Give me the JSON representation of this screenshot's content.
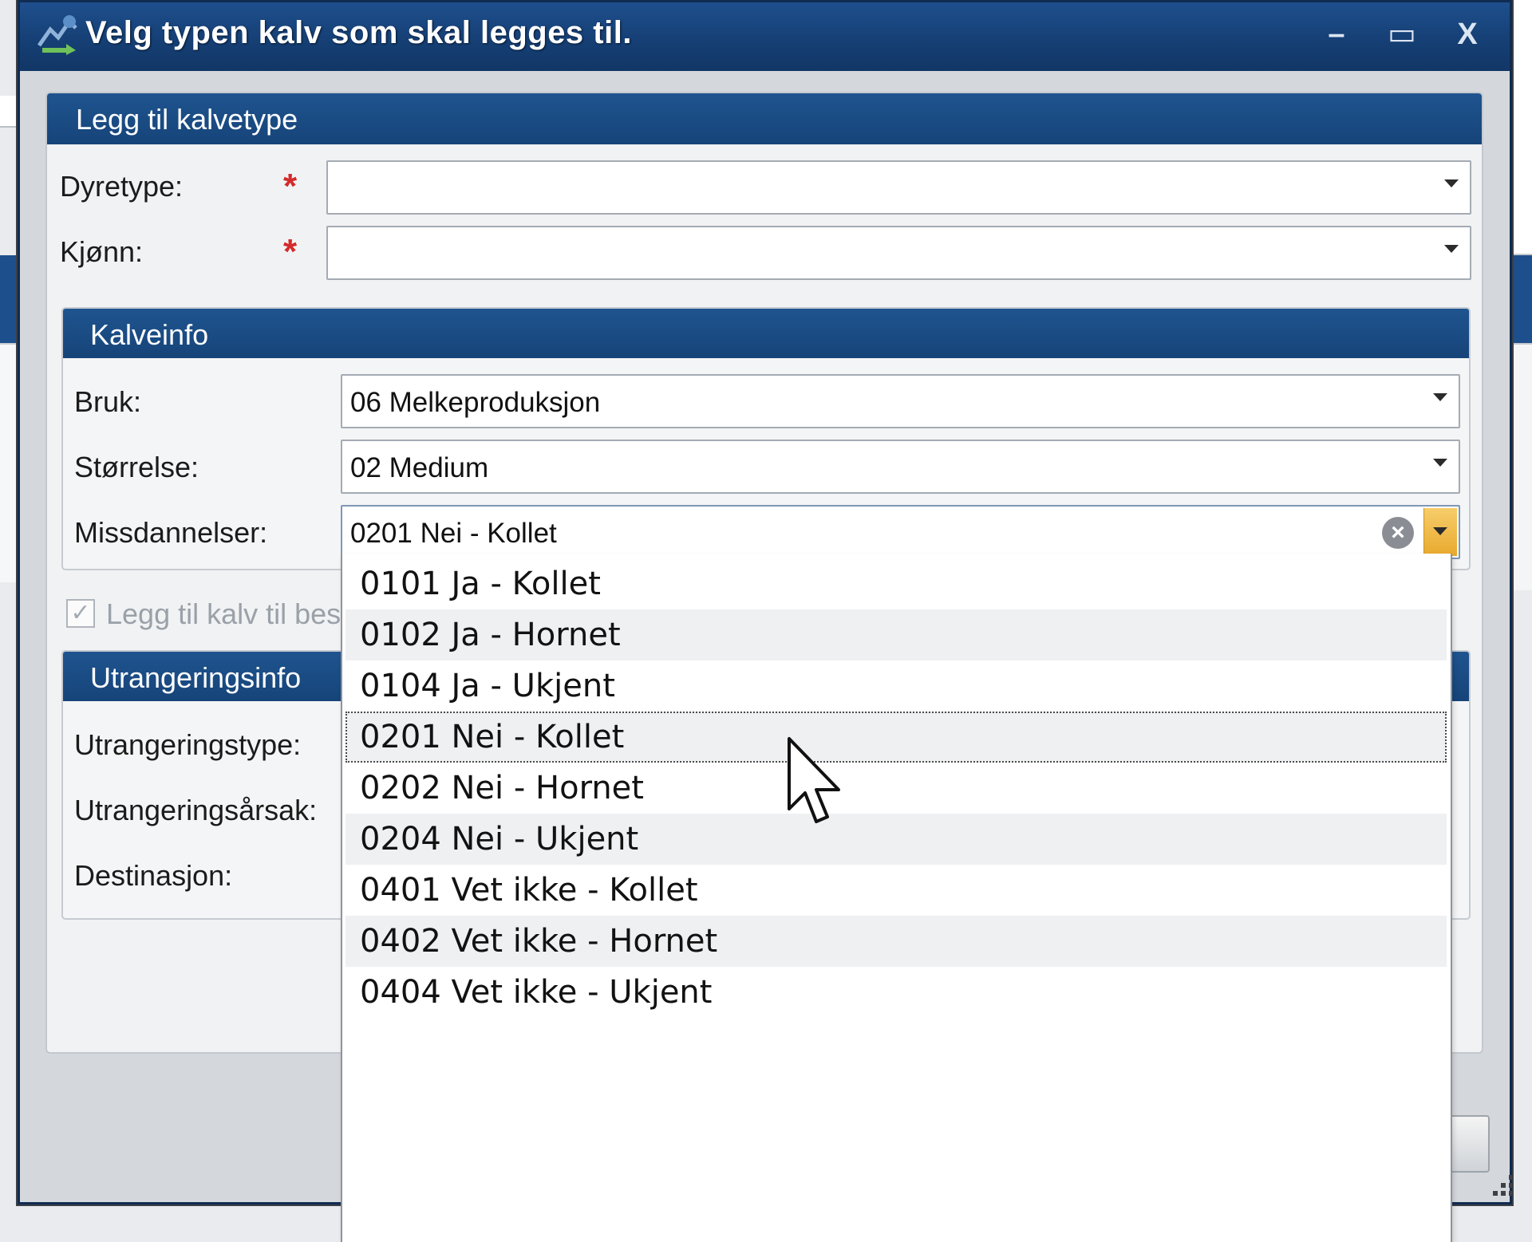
{
  "window": {
    "title": "Velg typen kalv som skal legges til.",
    "min_glyph": "–",
    "max_glyph": "▭",
    "close_glyph": "X"
  },
  "add_panel": {
    "title": "Legg til kalvetype",
    "fields": {
      "dyretype_label": "Dyretype:",
      "dyretype_value": "",
      "kjonn_label": "Kjønn:",
      "kjonn_value": "",
      "required_mark": "*"
    }
  },
  "kalveinfo": {
    "title": "Kalveinfo",
    "bruk_label": "Bruk:",
    "bruk_value": "06 Melkeproduksjon",
    "storrelse_label": "Størrelse:",
    "storrelse_value": "02 Medium",
    "missdannelser_label": "Missdannelser:",
    "missdannelser_value": "0201 Nei - Kollet",
    "clear_glyph": "×"
  },
  "checkbox": {
    "label": "Legg til kalv til bes",
    "checked_glyph": "✓"
  },
  "utrangering": {
    "title": "Utrangeringsinfo",
    "type_label": "Utrangeringstype:",
    "arsak_label": "Utrangeringsårsak:",
    "destinasjon_label": "Destinasjon:"
  },
  "dropdown": {
    "items": [
      "0101 Ja - Kollet",
      "0102 Ja - Hornet",
      "0104 Ja - Ukjent",
      "0201 Nei - Kollet",
      "0202 Nei - Hornet",
      "0204 Nei - Ukjent",
      "0401 Vet ikke - Kollet",
      "0402 Vet ikke - Hornet",
      "0404 Vet ikke - Ukjent"
    ],
    "selected_index": 3
  },
  "colors": {
    "title_bar": "#1e4f8d",
    "section_header": "#1f548f",
    "required": "#d42a2a",
    "active_arrow": "#f0b84a"
  },
  "icons": {
    "app": "app-logo-icon",
    "cursor": "mouse-pointer-icon",
    "grip": "resize-grip-icon"
  }
}
